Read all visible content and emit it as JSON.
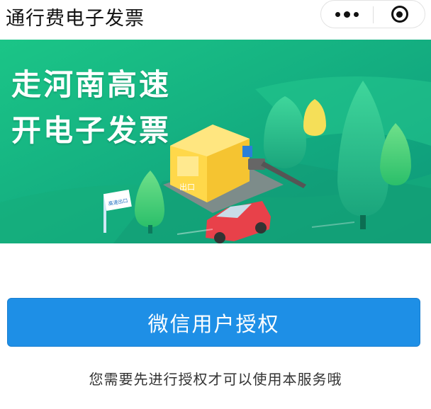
{
  "header": {
    "title": "通行费电子发票",
    "capsule": {
      "more_icon": "more-dots-icon",
      "close_icon": "mini-program-close-icon"
    }
  },
  "banner": {
    "line1": "走河南高速",
    "line2": "开电子发票",
    "booth_sign": "出口",
    "exit_sign": "高速出口",
    "colors": {
      "gradient_start": "#19c283",
      "gradient_end": "#0f9c7a"
    }
  },
  "auth": {
    "button_label": "微信用户授权",
    "hint": "您需要先进行授权才可以使用本服务哦",
    "colors": {
      "button": "#1e8fe6"
    }
  }
}
